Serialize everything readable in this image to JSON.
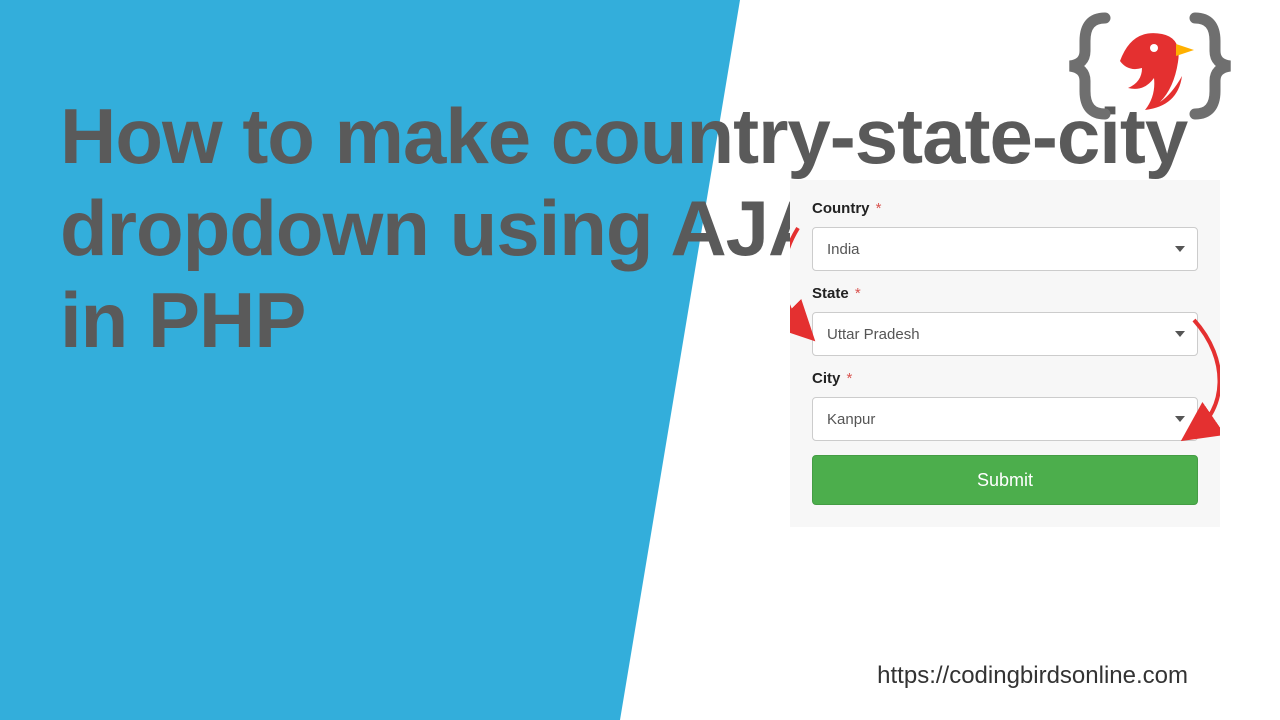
{
  "headline": "How to make country-state-city dropdown using AJAX\nin PHP",
  "form": {
    "country": {
      "label": "Country",
      "required": "*",
      "value": "India"
    },
    "state": {
      "label": "State",
      "required": "*",
      "value": "Uttar Pradesh"
    },
    "city": {
      "label": "City",
      "required": "*",
      "value": "Kanpur"
    },
    "submit": {
      "label": "Submit"
    }
  },
  "logo": {
    "brace_color": "#6f6f6f",
    "bird_color": "#e43030"
  },
  "site_url": "https://codingbirdsonline.com"
}
